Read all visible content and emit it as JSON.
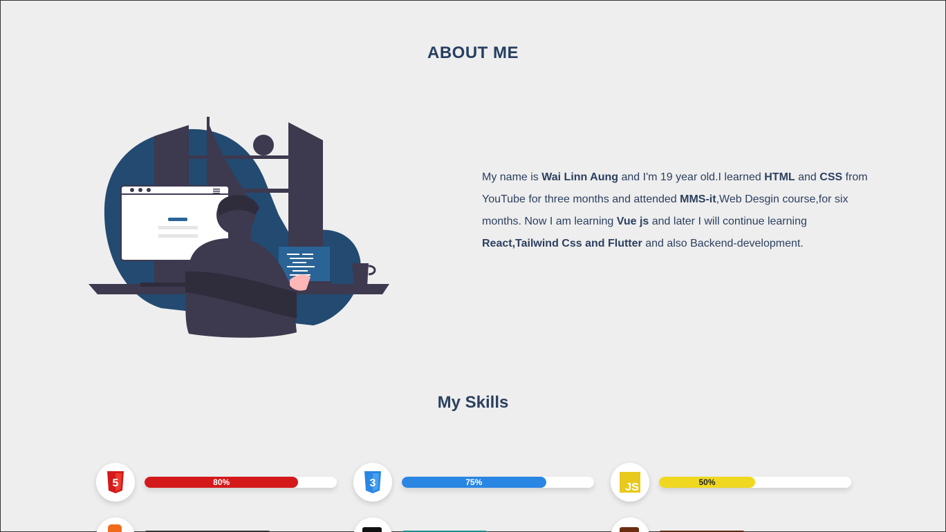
{
  "about": {
    "title": "ABOUT ME",
    "bio": {
      "p1": "My name is ",
      "name": "Wai Linn Aung",
      "p2": " and I'm 19 year old.I learned ",
      "html": "HTML",
      "p3": " and ",
      "css": "CSS",
      "p4": " from YouTube for three months and attended ",
      "mms": "MMS-it",
      "p5": ",Web Desgin course,for six months. Now I am learning ",
      "vue": "Vue js",
      "p6": " and later I will continue learning ",
      "future": "React,Tailwind Css and Flutter",
      "p7": " and also Backend-development."
    }
  },
  "skills": {
    "title": "My Skills",
    "items": [
      {
        "name": "HTML5",
        "icon": "html5-icon",
        "percent": 80,
        "label": "80%",
        "color": "#d4191a"
      },
      {
        "name": "CSS3",
        "icon": "css3-icon",
        "percent": 75,
        "label": "75%",
        "color": "#2a86e3"
      },
      {
        "name": "JavaScript",
        "icon": "js-icon",
        "percent": 50,
        "label": "50%",
        "color": "#f0d820"
      }
    ]
  },
  "colors": {
    "heading": "#263e61",
    "illustration_blob": "#234a70",
    "background": "#eeeeee"
  }
}
